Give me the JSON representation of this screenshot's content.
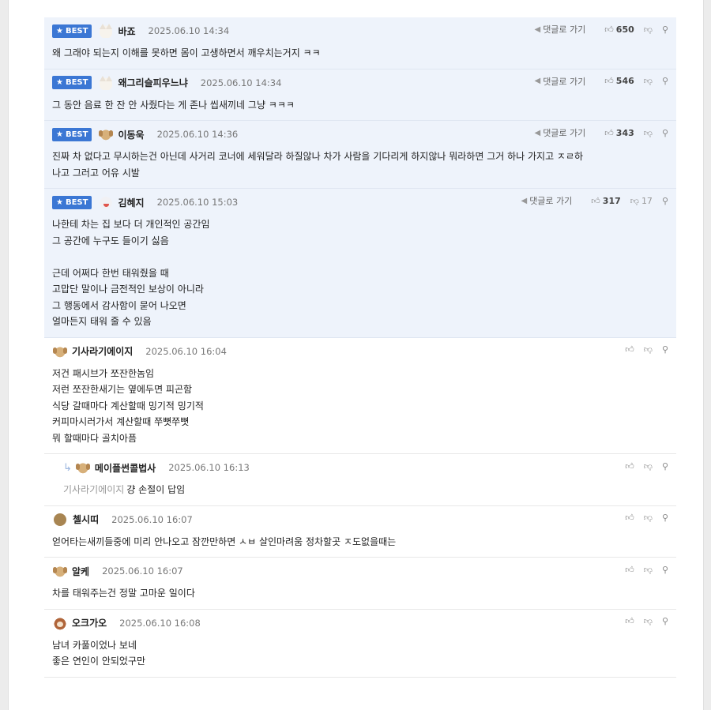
{
  "ui": {
    "best_label": "BEST",
    "goto_label": "댓글로 가기",
    "star_icon": "star-icon",
    "thumbs_up_icon": "thumbs-up-icon",
    "thumbs_down_icon": "thumbs-down-icon",
    "link_icon": "link-icon",
    "accent": "#3b77d4",
    "best_bg": "#eef3fb"
  },
  "comments": [
    {
      "best": true,
      "avatar": "cat",
      "nick": "바죠",
      "time": "2025.06.10 14:34",
      "likes": "650",
      "dislikes": "",
      "text": "왜 그래야 되는지 이해를 못하면 몸이 고생하면서 깨우치는거지 ㅋㅋ"
    },
    {
      "best": true,
      "avatar": "cat",
      "nick": "왜그리슬피우느냐",
      "time": "2025.06.10 14:34",
      "likes": "546",
      "dislikes": "",
      "text": "그 동안 음료 한 잔 안 사줬다는 게 존나 씹새끼네 그냥 ㅋㅋㅋ"
    },
    {
      "best": true,
      "avatar": "dog",
      "nick": "이동욱",
      "time": "2025.06.10 14:36",
      "likes": "343",
      "dislikes": "",
      "text": "진짜 차 없다고 무시하는건 아닌데 사거리 코너에 세워달라 하질않나 차가 사람을 기다리게 하지않나 뭐라하면 그거 하나 가지고 ㅈㄹ하\n나고 그러고 어유 시발"
    },
    {
      "best": true,
      "avatar": "seal",
      "nick": "김혜지",
      "time": "2025.06.10 15:03",
      "likes": "317",
      "dislikes": "17",
      "text": "나한테 차는 집 보다 더 개인적인 공간임\n그 공간에 누구도 들이기 싫음\n\n근데 어쩌다 한번 태워줬을 때\n고맙단 말이나 금전적인 보상이 아니라\n그 행동에서 감사함이 묻어 나오면\n얼마든지 태워 줄 수 있음"
    },
    {
      "best": false,
      "avatar": "dog",
      "nick": "기사라기에이지",
      "time": "2025.06.10 16:04",
      "likes": "",
      "dislikes": "",
      "text": "저건 패시브가 쪼잔한놈임\n저런 쪼잔한새기는 옆에두면 피곤함\n식당 갈때마다 계산할때 밍기적 밍기적\n커피마시러가서 계산할때 쭈뼛쭈뼛\n뭐 할때마다 골치아픔"
    },
    {
      "best": false,
      "reply": true,
      "avatar": "dog",
      "nick": "메이플썬콜법사",
      "time": "2025.06.10 16:13",
      "likes": "",
      "dislikes": "",
      "mention": "기사라기에이지",
      "text": "걍 손절이 답임"
    },
    {
      "best": false,
      "avatar": "ball",
      "nick": "첼시띠",
      "time": "2025.06.10 16:07",
      "likes": "",
      "dislikes": "",
      "text": "얻어타는새끼들중에 미리 안나오고 잠깐만하면 ㅅㅂ 살인마려움 정차할곳 ㅈ도없을때는"
    },
    {
      "best": false,
      "avatar": "dog",
      "nick": "알케",
      "time": "2025.06.10 16:07",
      "likes": "",
      "dislikes": "",
      "text": "차를 태워주는건 정말 고마운 일이다"
    },
    {
      "best": false,
      "avatar": "poodle",
      "nick": "오크가오",
      "time": "2025.06.10 16:08",
      "likes": "",
      "dislikes": "",
      "text": "남녀 카풀이었나 보네\n좋은 연인이 안되었구만"
    }
  ]
}
